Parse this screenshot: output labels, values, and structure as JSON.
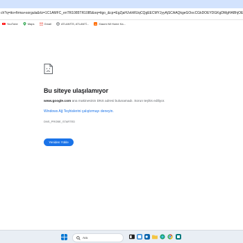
{
  "browser": {
    "address_url": "ch?q=ito+firma+sorgula&rlz=1C1AMFC_enTR1085TR1085&oq=itgo_&cp=EgZjaHJvbWUqCQgEECMYJyyAjSCAAQkgeGOocCGkDOEYDGKgDMgHABhjOEG"
  },
  "bookmarks": [
    {
      "label": "YouTube",
      "icon": "youtube-icon"
    },
    {
      "label": "Maps",
      "icon": "maps-icon"
    },
    {
      "label": "Gmail",
      "icon": "gmail-icon"
    },
    {
      "label": "ATLANTİS, ATLANTİ...",
      "icon": "globe-icon"
    },
    {
      "label": "Xiaomi Mi Home Ka...",
      "icon": "xiaomi-icon"
    }
  ],
  "error": {
    "title": "Bu siteye ulaşılamıyor",
    "host": "www.google.com",
    "message": " ana makinesinin DNS adresi bulunamadı. Sorun teşhis ediliyor.",
    "diagnostics_link": "Windows Ağ Teşhislerini çalıştırmayı deneyin.",
    "code": "DNS_PROBE_STARTED",
    "reload_button": "Yeniden Yükle"
  },
  "taskbar": {
    "search_placeholder": "Ara"
  },
  "colors": {
    "accent": "#1a73e8",
    "tab_strip": "#d3e3fd"
  }
}
